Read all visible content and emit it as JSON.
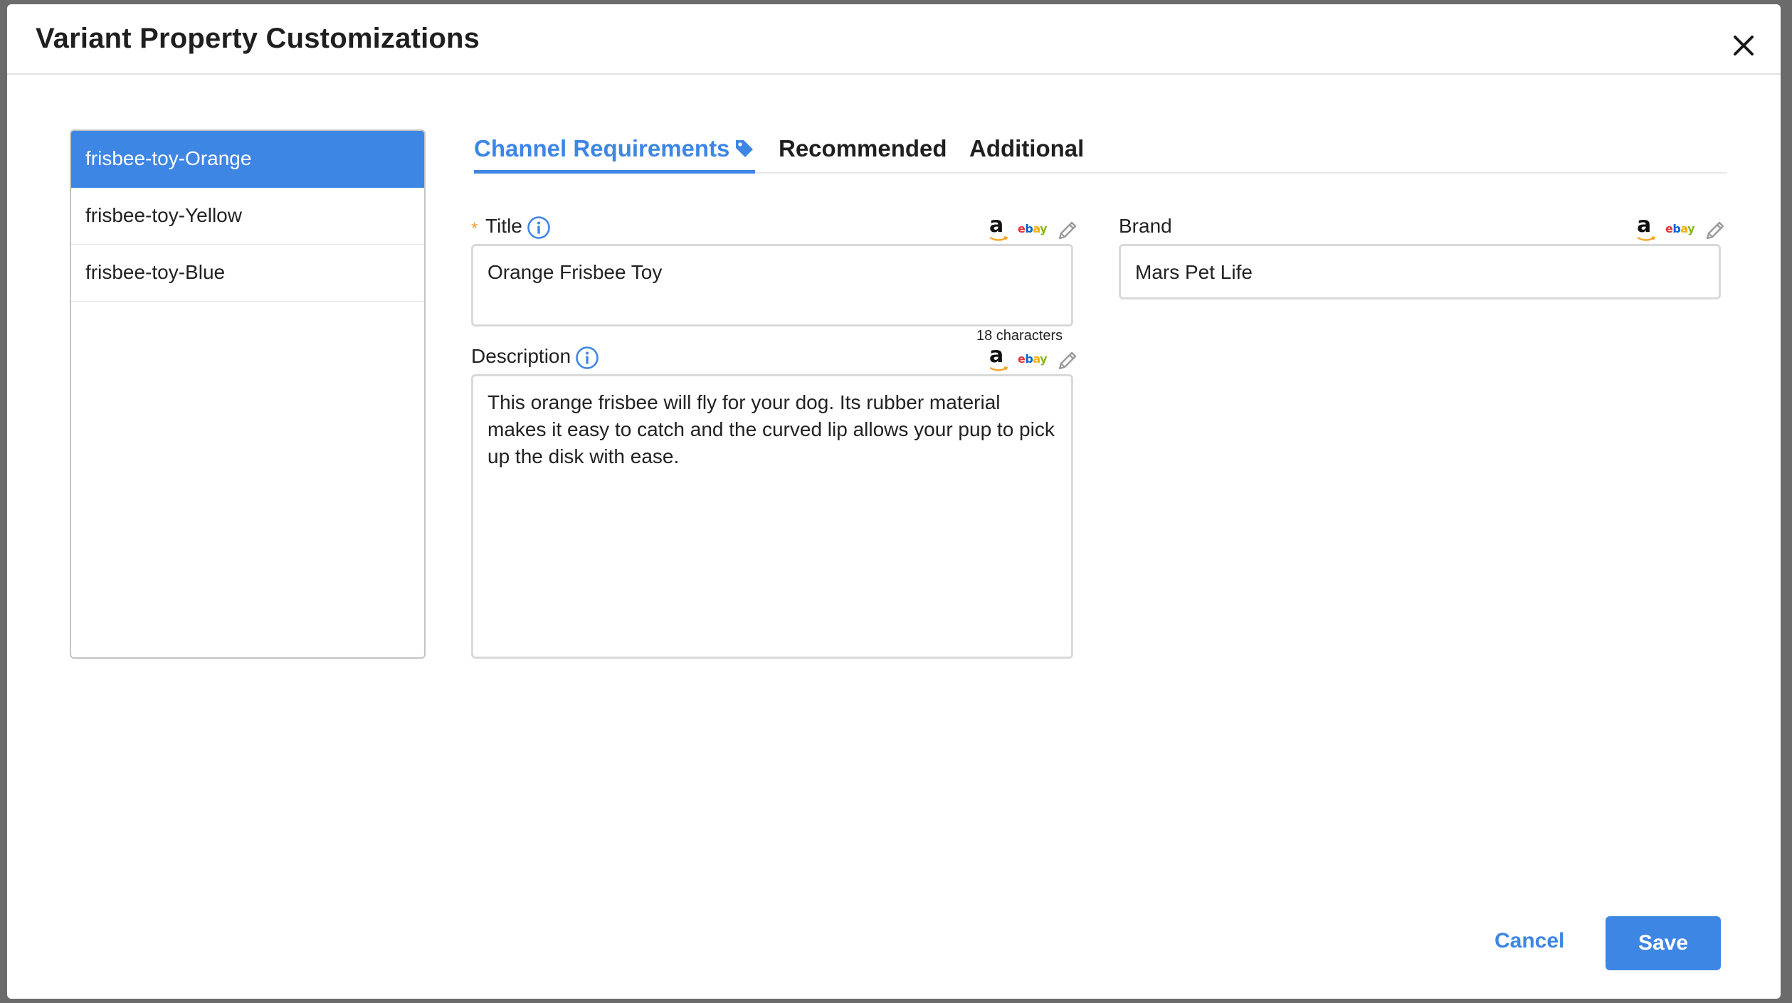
{
  "modal": {
    "title": "Variant Property Customizations"
  },
  "variants": [
    {
      "label": "frisbee-toy-Orange",
      "selected": true
    },
    {
      "label": "frisbee-toy-Yellow",
      "selected": false
    },
    {
      "label": "frisbee-toy-Blue",
      "selected": false
    }
  ],
  "tabs": [
    {
      "label": "Channel Requirements",
      "active": true
    },
    {
      "label": "Recommended",
      "active": false
    },
    {
      "label": "Additional",
      "active": false
    }
  ],
  "fields": {
    "title": {
      "label": "Title",
      "required_mark": "*",
      "value": "Orange Frisbee Toy",
      "char_count": "18 characters"
    },
    "description": {
      "label": "Description",
      "value": "This orange frisbee will fly for your dog. Its rubber material makes it easy to catch and the curved lip allows your pup to pick up the disk with ease."
    },
    "brand": {
      "label": "Brand",
      "value": "Mars Pet Life"
    }
  },
  "channels": {
    "amazon_glyph": "a",
    "ebay_letters": [
      "e",
      "b",
      "a",
      "y"
    ]
  },
  "icons": [
    "close-icon",
    "tag-icon",
    "info-icon",
    "amazon-icon",
    "ebay-icon",
    "pencil-icon"
  ],
  "colors": {
    "accent": "#3e86e4",
    "required": "#f29a3a",
    "ebay_e": "#e53238",
    "ebay_b": "#0064d2",
    "ebay_a": "#f5af02",
    "ebay_y": "#86b817"
  },
  "footer": {
    "cancel_label": "Cancel",
    "save_label": "Save"
  }
}
